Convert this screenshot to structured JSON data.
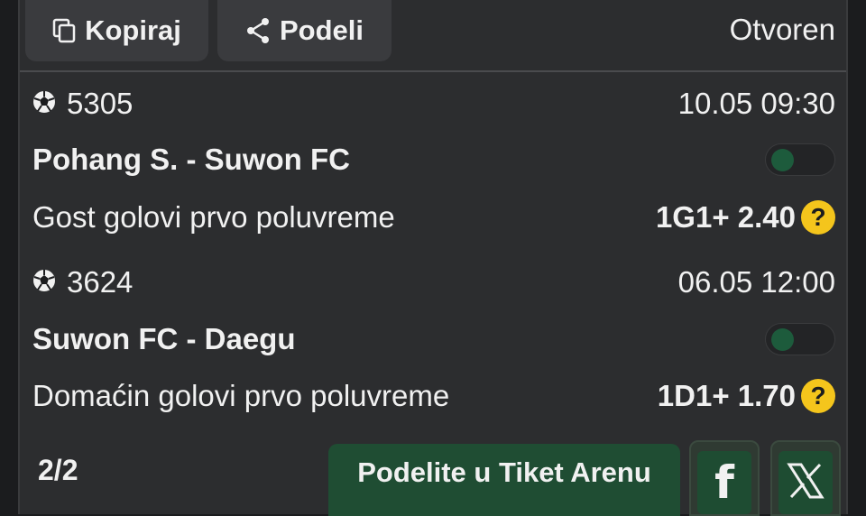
{
  "toolbar": {
    "copy_label": "Kopiraj",
    "share_label": "Podeli",
    "status": "Otvoren"
  },
  "bets": [
    {
      "code": "5305",
      "datetime": "10.05 09:30",
      "match": "Pohang S. - Suwon FC",
      "market": "Gost golovi prvo poluvreme",
      "pick": "1G1+ 2.40"
    },
    {
      "code": "3624",
      "datetime": "06.05 12:00",
      "match": "Suwon FC - Daegu",
      "market": "Domaćin golovi prvo poluvreme",
      "pick": "1D1+ 1.70"
    }
  ],
  "footer": {
    "count": "2/2",
    "arena_label": "Podelite u Tiket Arenu",
    "facebook_glyph": "f"
  },
  "icons": {
    "copy": "copy-icon",
    "share": "share-icon",
    "sport": "soccer-ball-icon",
    "help": "question-icon",
    "x": "x-logo-icon"
  },
  "colors": {
    "accent_green": "#1f4d33",
    "help_yellow": "#f4c51c",
    "toggle_knob": "#1d5b3c"
  },
  "help_glyph": "?"
}
